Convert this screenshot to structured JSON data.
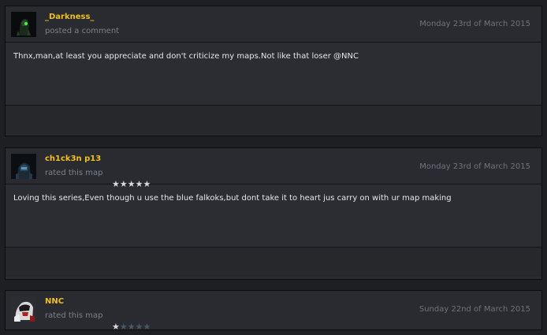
{
  "comments": [
    {
      "username": "_Darkness_",
      "action": "posted a comment",
      "date": "Monday 23rd of March 2015",
      "text": "Thnx,man,at least you appreciate and don't criticize my maps.Not like that loser @NNC"
    },
    {
      "username": "ch1ck3n p13",
      "action": "rated this map",
      "date": "Monday 23rd of March 2015",
      "rating": 5,
      "rating_max": 5,
      "text": "Loving this series,Even though u use the blue falkoks,but dont take it to heart jus carry on with ur map making"
    },
    {
      "username": "NNC",
      "action": "rated this map",
      "date": "Sunday 22nd of March 2015",
      "rating": 1,
      "rating_max": 5
    }
  ],
  "colors": {
    "username": "#f0c01e",
    "star_on": "#d8dadd",
    "star_off": "#4a5868"
  }
}
